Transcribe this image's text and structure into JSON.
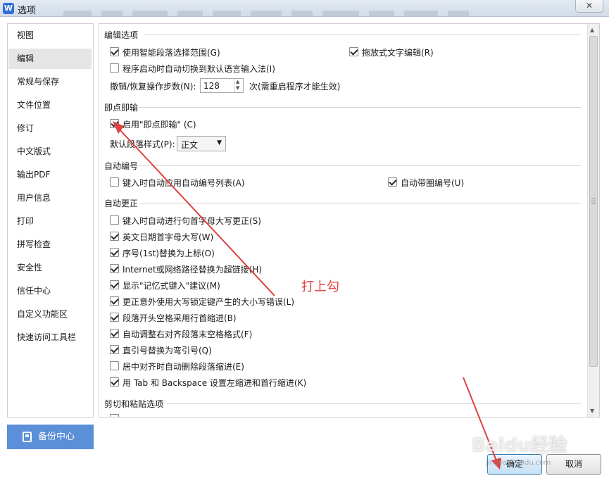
{
  "window": {
    "title": "选项",
    "close_glyph": "✕"
  },
  "nav": {
    "items": [
      {
        "label": "视图"
      },
      {
        "label": "编辑"
      },
      {
        "label": "常规与保存"
      },
      {
        "label": "文件位置"
      },
      {
        "label": "修订"
      },
      {
        "label": "中文版式"
      },
      {
        "label": "输出PDF"
      },
      {
        "label": "用户信息"
      },
      {
        "label": "打印"
      },
      {
        "label": "拼写检查"
      },
      {
        "label": "安全性"
      },
      {
        "label": "信任中心"
      },
      {
        "label": "自定义功能区"
      },
      {
        "label": "快速访问工具栏"
      }
    ],
    "active": "编辑",
    "backup_label": "备份中心"
  },
  "content": {
    "edit_options": {
      "title": "编辑选项",
      "smart_select": {
        "label": "使用智能段落选择范围(G)",
        "checked": true
      },
      "drag_drop": {
        "label": "拖放式文字编辑(R)",
        "checked": true
      },
      "auto_ime": {
        "label": "程序启动时自动切换到默认语言输入法(I)",
        "checked": false
      },
      "undo_label": "撤销/恢复操作步数(N):",
      "undo_value": "128",
      "undo_suffix": "次(需重启程序才能生效)"
    },
    "click_type": {
      "title": "即点即输",
      "enable": {
        "label": "启用\"即点即输\" (C)",
        "checked": true
      },
      "default_style_label": "默认段落样式(P):",
      "default_style_value": "正文"
    },
    "auto_number": {
      "title": "自动编号",
      "auto_list": {
        "label": "键入时自动应用自动编号列表(A)",
        "checked": false
      },
      "circle_number": {
        "label": "自动带圈编号(U)",
        "checked": true
      }
    },
    "autocorrect": {
      "title": "自动更正",
      "items": [
        {
          "label": "键入时自动进行句首字母大写更正(S)",
          "checked": false
        },
        {
          "label": "英文日期首字母大写(W)",
          "checked": true
        },
        {
          "label": "序号(1st)替换为上标(O)",
          "checked": true
        },
        {
          "label": "Internet或网络路径替换为超链接(H)",
          "checked": true
        },
        {
          "label": "显示\"记忆式键入\"建议(M)",
          "checked": true
        },
        {
          "label": "更正意外使用大写锁定键产生的大小写错误(L)",
          "checked": true
        },
        {
          "label": "段落开头空格采用行首缩进(B)",
          "checked": true
        },
        {
          "label": "自动调整右对齐段落末空格格式(F)",
          "checked": true
        },
        {
          "label": "直引号替换为弯引号(Q)",
          "checked": true
        },
        {
          "label": "居中对齐时自动删除段落缩进(E)",
          "checked": false
        },
        {
          "label": "用 Tab 和 Backspace 设置左缩进和首行缩进(K)",
          "checked": true
        }
      ]
    },
    "paste": {
      "title": "剪切和粘贴选项"
    }
  },
  "buttons": {
    "ok": "确定",
    "cancel": "取消"
  },
  "annotation": {
    "text": "打上勾",
    "color": "#e04040"
  },
  "watermark": {
    "text": "Baidu经验",
    "sub": "jingyan.baidu.com"
  },
  "colors": {
    "accent": "#5b8fd7",
    "active_nav": "#e5e5e5",
    "annotation": "#e04040"
  }
}
